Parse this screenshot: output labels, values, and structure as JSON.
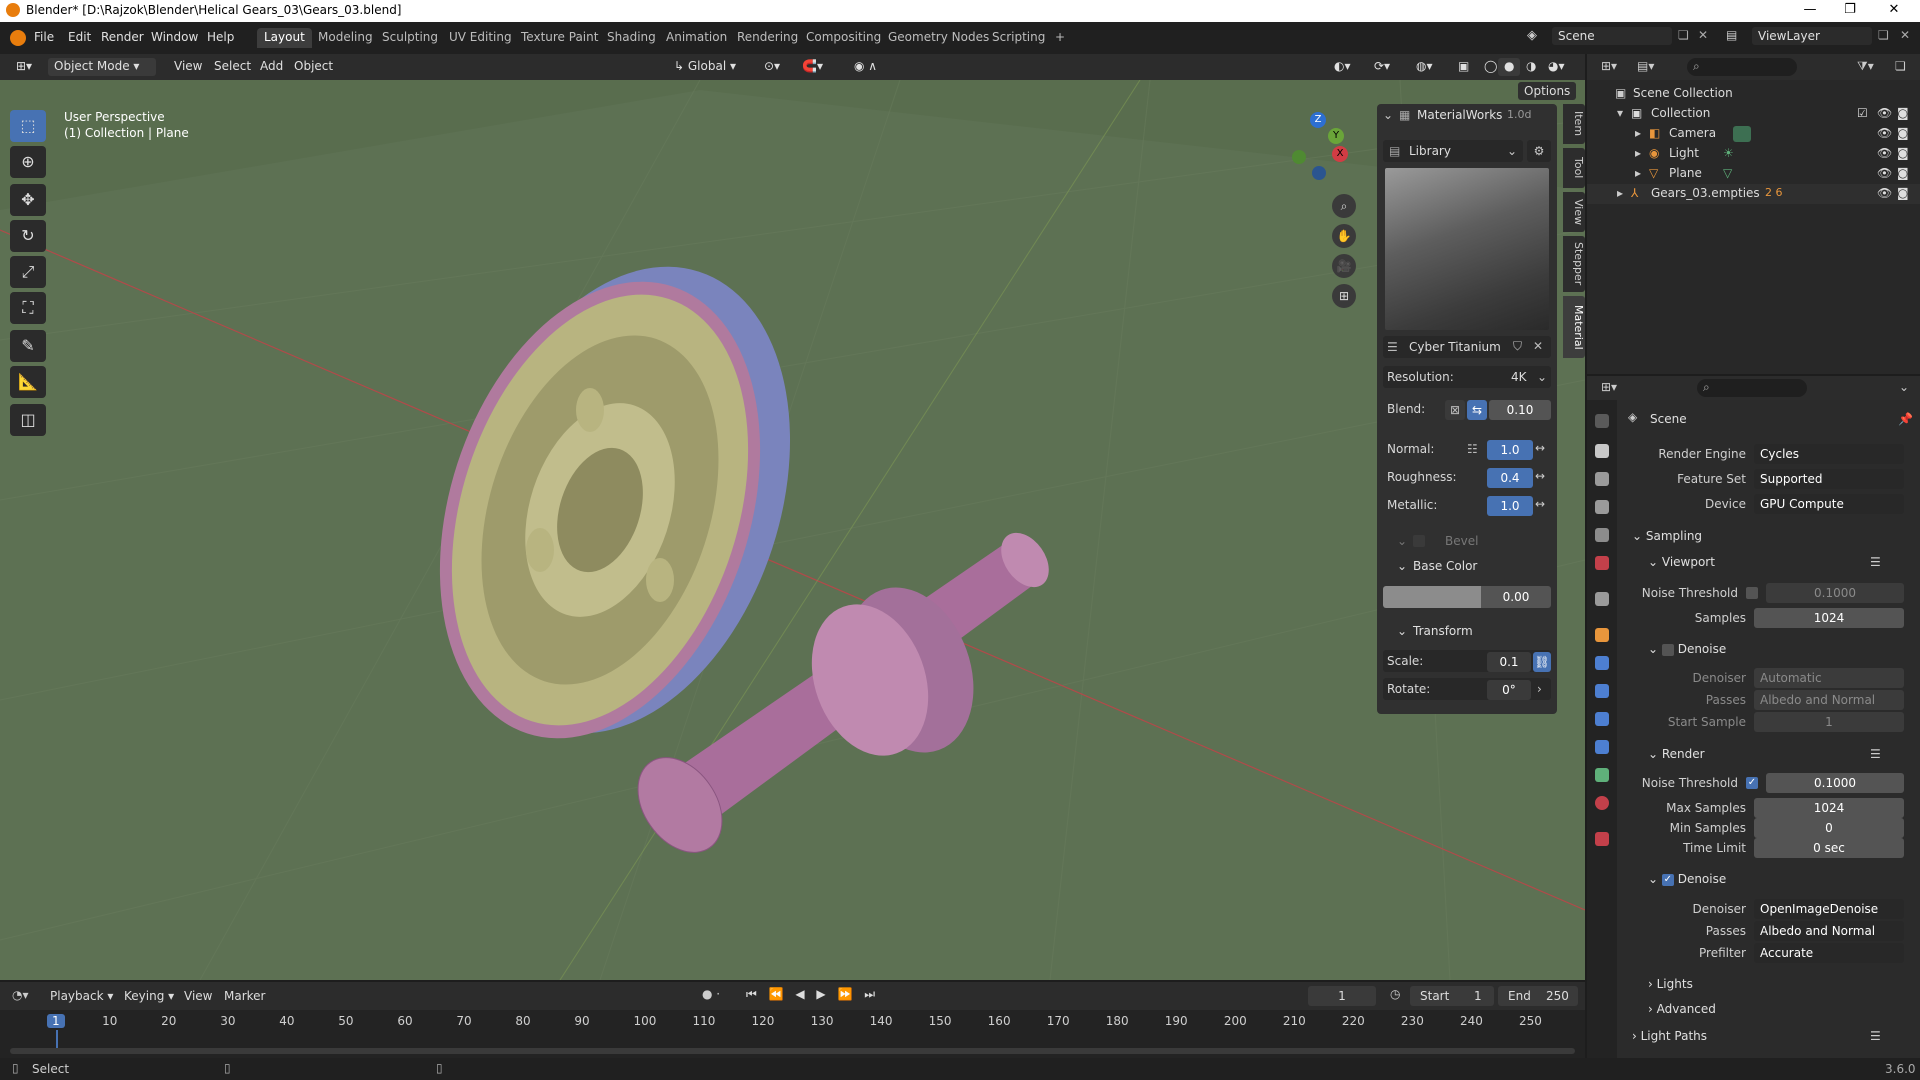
{
  "window": {
    "title": "Blender* [D:\\Rajzok\\Blender\\Helical Gears_03\\Gears_03.blend]",
    "minimize": "—",
    "maximize": "❐",
    "close": "✕"
  },
  "menu": [
    "File",
    "Edit",
    "Render",
    "Window",
    "Help"
  ],
  "workspaces": [
    "Layout",
    "Modeling",
    "Sculpting",
    "UV Editing",
    "Texture Paint",
    "Shading",
    "Animation",
    "Rendering",
    "Compositing",
    "Geometry Nodes",
    "Scripting",
    "+"
  ],
  "scene_field": "Scene",
  "viewlayer_field": "ViewLayer",
  "viewport_header": {
    "mode": "Object Mode",
    "menus": [
      "View",
      "Select",
      "Add",
      "Object"
    ],
    "orientation": "Global",
    "options": "Options"
  },
  "viewport": {
    "perspective": "User Perspective",
    "collection": "(1) Collection | Plane",
    "gizmo_axes": [
      "X",
      "Y",
      "Z"
    ]
  },
  "material_panel": {
    "title": "MaterialWorks",
    "version": "1.0d",
    "library": "Library",
    "material_name": "Cyber Titanium",
    "resolution_label": "Resolution:",
    "resolution_value": "4K",
    "blend_label": "Blend:",
    "blend_value": "0.10",
    "normal_label": "Normal:",
    "normal_value": "1.0",
    "roughness_label": "Roughness:",
    "roughness_value": "0.4",
    "metallic_label": "Metallic:",
    "metallic_value": "1.0",
    "bevel": "Bevel",
    "base_color": "Base Color",
    "base_color_value": "0.00",
    "transform": "Transform",
    "scale_label": "Scale:",
    "scale_value": "0.1",
    "rotate_label": "Rotate:",
    "rotate_value": "0°"
  },
  "side_tabs": [
    "Item",
    "Tool",
    "View",
    "Stepper",
    "Material"
  ],
  "outliner": {
    "root": "Scene Collection",
    "items": [
      {
        "name": "Collection",
        "indent": 1
      },
      {
        "name": "Camera",
        "indent": 2
      },
      {
        "name": "Light",
        "indent": 2
      },
      {
        "name": "Plane",
        "indent": 2
      },
      {
        "name": "Gears_03.empties",
        "indent": 1
      }
    ],
    "empties_counts": "2 6"
  },
  "properties": {
    "context": "Scene",
    "render_engine_label": "Render Engine",
    "render_engine": "Cycles",
    "feature_set_label": "Feature Set",
    "feature_set": "Supported",
    "device_label": "Device",
    "device": "GPU Compute",
    "sampling": "Sampling",
    "viewport": "Viewport",
    "noise_threshold_label": "Noise Threshold",
    "vp_noise_threshold": "0.1000",
    "samples_label": "Samples",
    "vp_samples": "1024",
    "denoise": "Denoise",
    "denoiser_label": "Denoiser",
    "vp_denoiser": "Automatic",
    "passes_label": "Passes",
    "vp_passes": "Albedo and Normal",
    "start_sample_label": "Start Sample",
    "vp_start_sample": "1",
    "render": "Render",
    "r_noise_threshold": "0.1000",
    "max_samples_label": "Max Samples",
    "r_max_samples": "1024",
    "min_samples_label": "Min Samples",
    "r_min_samples": "0",
    "time_limit_label": "Time Limit",
    "r_time_limit": "0 sec",
    "r_denoiser": "OpenImageDenoise",
    "r_passes": "Albedo and Normal",
    "prefilter_label": "Prefilter",
    "r_prefilter": "Accurate",
    "lights": "Lights",
    "advanced": "Advanced",
    "light_paths": "Light Paths"
  },
  "timeline": {
    "menus": [
      "Playback",
      "Keying",
      "View",
      "Marker"
    ],
    "current_frame": "1",
    "start_label": "Start",
    "start": "1",
    "end_label": "End",
    "end": "250",
    "ticks": [
      "1",
      "10",
      "20",
      "30",
      "40",
      "50",
      "60",
      "70",
      "80",
      "90",
      "100",
      "110",
      "120",
      "130",
      "140",
      "150",
      "160",
      "170",
      "180",
      "190",
      "200",
      "210",
      "220",
      "230",
      "240",
      "250"
    ]
  },
  "status": {
    "left": "Select",
    "version": "3.6.0"
  },
  "colors": {
    "accent": "#4772b3",
    "viewport": "#596d4e",
    "gear_main": "#b07a9e",
    "gear_blue": "#6f79b4",
    "gear_face": "#b8b480",
    "blender_orange": "#e87d0d"
  }
}
